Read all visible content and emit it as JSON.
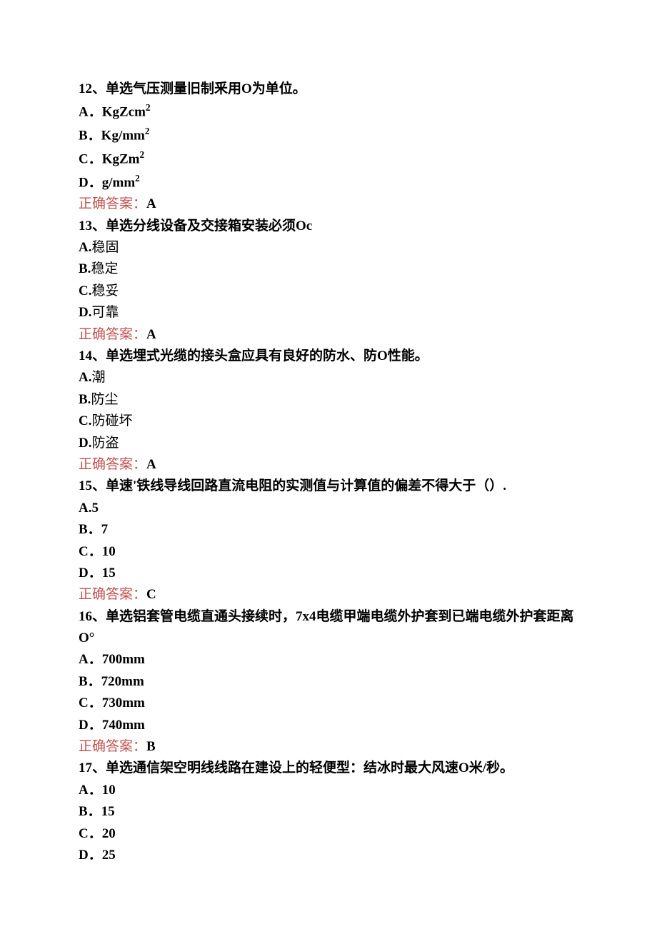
{
  "answer_label": "正确答案：",
  "questions": [
    {
      "id": "q12",
      "stem": "12、单选气压测量旧制釆用O为单位。",
      "options": [
        {
          "text": "A．KgZcm",
          "sup": "2"
        },
        {
          "text": "B．Kg/mm",
          "sup": "2"
        },
        {
          "text": "C．KgZm",
          "sup": "2"
        },
        {
          "text": "D．g/mm",
          "sup": "2"
        }
      ],
      "answer": "A",
      "options_bold": true
    },
    {
      "id": "q13",
      "stem": "13、单选分线设备及交接箱安装必须Oc",
      "options": [
        {
          "text": "A.稳固"
        },
        {
          "text": "B.稳定"
        },
        {
          "text": "C.稳妥"
        },
        {
          "text": "D.可靠"
        }
      ],
      "answer": "A",
      "options_bold": false,
      "prefix_bold": true
    },
    {
      "id": "q14",
      "stem": "14、单选埋式光缆的接头盒应具有良好的防水、防O性能。",
      "options": [
        {
          "text": "A.潮"
        },
        {
          "text": "B.防尘"
        },
        {
          "text": "C.防碰坏"
        },
        {
          "text": "D.防盗"
        }
      ],
      "answer": "A",
      "options_bold": false,
      "prefix_bold": true
    },
    {
      "id": "q15",
      "stem": "15、单速'铁线导线回路直流电阻的实测值与计算值的偏差不得大于（）.",
      "options": [
        {
          "text": "A.5"
        },
        {
          "text": "B．7"
        },
        {
          "text": "C．10"
        },
        {
          "text": "D．15"
        }
      ],
      "answer": "C",
      "options_bold": true
    },
    {
      "id": "q16",
      "stem": "16、单选铝套管电缆直通头接续时，7x4电缆甲端电缆外护套到已端电缆外护套距离O°",
      "options": [
        {
          "text": "A．700mm"
        },
        {
          "text": "B．720mm"
        },
        {
          "text": "C．730mm"
        },
        {
          "text": "D．740mm"
        }
      ],
      "answer": "B",
      "options_bold": true
    },
    {
      "id": "q17",
      "stem": "17、单选通信架空明线线路在建设上的轻便型：结冰时最大风速O米/秒。",
      "options": [
        {
          "text": "A．10"
        },
        {
          "text": "B．15"
        },
        {
          "text": "C．20"
        },
        {
          "text": "D．25"
        }
      ],
      "answer": null,
      "options_bold": true
    }
  ]
}
